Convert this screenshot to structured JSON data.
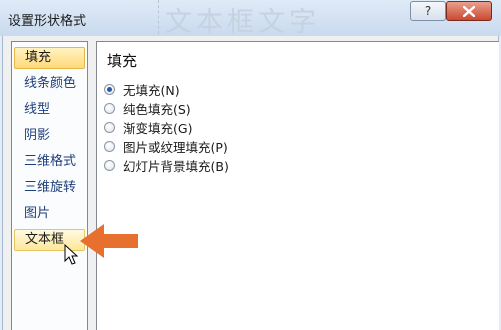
{
  "window": {
    "title": "设置形状格式",
    "background_text": "文本框文字",
    "help_label": "?"
  },
  "sidebar": {
    "items": [
      {
        "label": "填充",
        "state": "selected"
      },
      {
        "label": "线条颜色"
      },
      {
        "label": "线型"
      },
      {
        "label": "阴影"
      },
      {
        "label": "三维格式"
      },
      {
        "label": "三维旋转"
      },
      {
        "label": "图片"
      },
      {
        "label": "文本框",
        "state": "hover"
      }
    ]
  },
  "main": {
    "title": "填充",
    "options": [
      {
        "label": "无填充(N)",
        "checked": true
      },
      {
        "label": "纯色填充(S)",
        "checked": false
      },
      {
        "label": "渐变填充(G)",
        "checked": false
      },
      {
        "label": "图片或纹理填充(P)",
        "checked": false
      },
      {
        "label": "幻灯片背景填充(B)",
        "checked": false
      }
    ]
  },
  "colors": {
    "accent_arrow": "#e8702e",
    "selected_item_bg": "#ffd97a",
    "close_button": "#c94a32"
  }
}
